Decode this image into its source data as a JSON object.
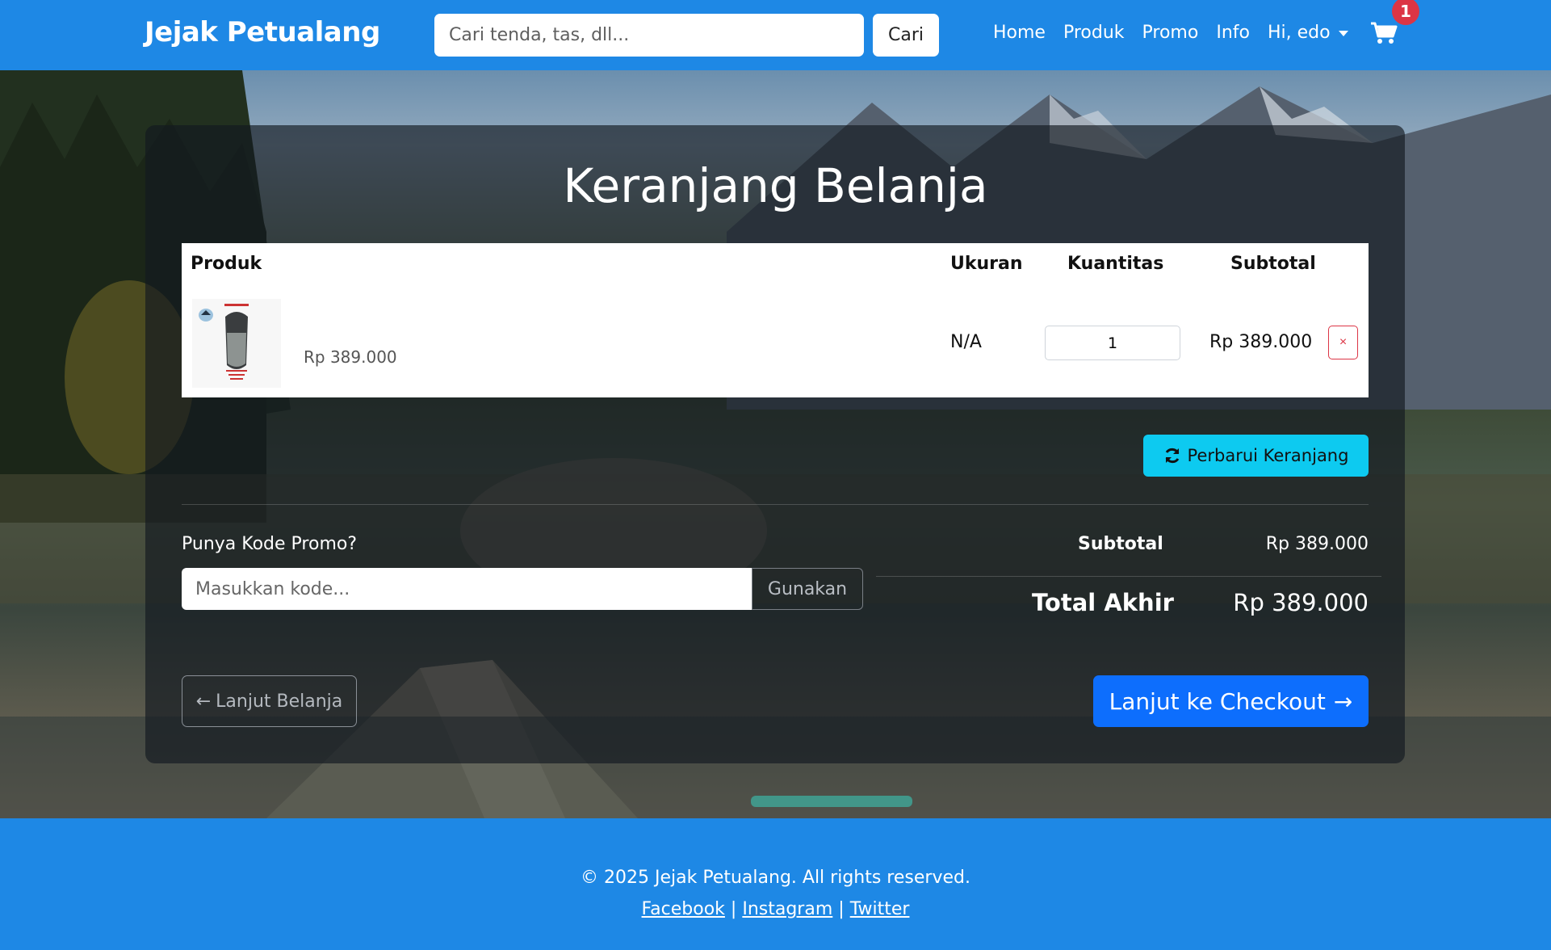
{
  "navbar": {
    "brand": "Jejak Petualang",
    "search_placeholder": "Cari tenda, tas, dll...",
    "search_button": "Cari",
    "links": [
      "Home",
      "Produk",
      "Promo",
      "Info"
    ],
    "user_menu": "Hi, edo",
    "cart_count": "1"
  },
  "cart": {
    "title": "Keranjang Belanja",
    "columns": {
      "product": "Produk",
      "size": "Ukuran",
      "quantity": "Kuantitas",
      "subtotal": "Subtotal"
    },
    "items": [
      {
        "price": "Rp 389.000",
        "size": "N/A",
        "quantity": "1",
        "subtotal": "Rp 389.000",
        "remove": "×"
      }
    ],
    "update_button": "Perbarui Keranjang"
  },
  "promo": {
    "label": "Punya Kode Promo?",
    "placeholder": "Masukkan kode...",
    "apply_button": "Gunakan"
  },
  "summary": {
    "subtotal_label": "Subtotal",
    "subtotal_value": "Rp 389.000",
    "total_label": "Total Akhir",
    "total_value": "Rp 389.000"
  },
  "actions": {
    "continue_shopping": "Lanjut Belanja",
    "checkout": "Lanjut ke Checkout"
  },
  "footer": {
    "copyright": "© 2025 Jejak Petualang. All rights reserved.",
    "social": [
      "Facebook",
      "Instagram",
      "Twitter"
    ],
    "separator": "|"
  },
  "colors": {
    "navbar": "#1e88e5",
    "badge": "#dc3545",
    "update_button": "#0dcaf0",
    "checkout_button": "#0d6efd"
  }
}
